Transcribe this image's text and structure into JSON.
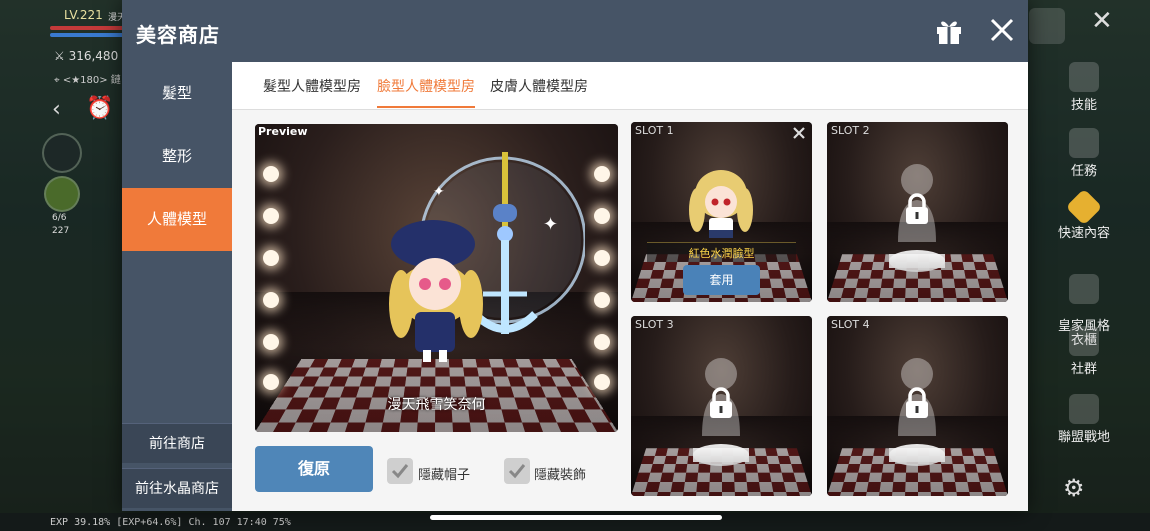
{
  "hud": {
    "level": "LV.221",
    "name_fragment": "漫天",
    "power": "316,480",
    "position": "<★180> 鏈",
    "stats_a": "6/6",
    "stats_b": "227",
    "exp_line": "EXP 39.18%   [EXP+64.6%]  Ch. 107  17:40      75%",
    "right_menu": [
      {
        "label": "技能",
        "icon": "skill-icon"
      },
      {
        "label": "任務",
        "icon": "quest-icon"
      },
      {
        "label": "快速內容",
        "icon": "quick-content-icon"
      },
      {
        "label": "皇家風格\n衣櫃",
        "icon": "wardrobe-icon"
      },
      {
        "label": "社群",
        "icon": "community-icon"
      },
      {
        "label": "聯盟戰地",
        "icon": "union-icon"
      }
    ]
  },
  "modal": {
    "title": "美容商店",
    "header_icons": [
      "gift-icon",
      "close-icon"
    ],
    "sidebar": {
      "items": [
        {
          "label": "髮型",
          "active": false
        },
        {
          "label": "整形",
          "active": false
        },
        {
          "label": "人體模型",
          "active": true
        }
      ],
      "bottom_items": [
        {
          "label": "前往商店"
        },
        {
          "label": "前往水晶商店"
        }
      ]
    },
    "tabs": [
      {
        "label": "髮型人體模型房",
        "active": false
      },
      {
        "label": "臉型人體模型房",
        "active": true
      },
      {
        "label": "皮膚人體模型房",
        "active": false
      }
    ],
    "preview": {
      "label": "Preview",
      "character_name": "漫天飛雪笑奈何"
    },
    "slots": [
      {
        "label": "SLOT 1",
        "locked": false,
        "item_name": "紅色水潤臉型",
        "apply_label": "套用"
      },
      {
        "label": "SLOT 2",
        "locked": true
      },
      {
        "label": "SLOT 3",
        "locked": true
      },
      {
        "label": "SLOT 4",
        "locked": true
      }
    ],
    "reset_label": "復原",
    "checkboxes": [
      {
        "label": "隱藏帽子",
        "checked": true
      },
      {
        "label": "隱藏裝飾",
        "checked": true
      }
    ]
  },
  "colors": {
    "header": "#465466",
    "accent": "#f07a3a",
    "button_blue": "#4f86b8"
  }
}
